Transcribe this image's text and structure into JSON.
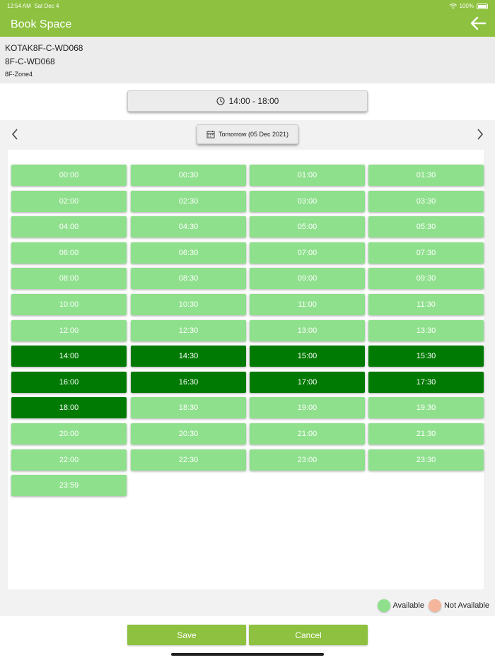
{
  "status": {
    "time": "12:54 AM",
    "date": "Sat Dec 4",
    "battery": "100%"
  },
  "header": {
    "title": "Book Space"
  },
  "space": {
    "code": "KOTAK8F-C-WD068",
    "desk": "8F-C-WD068",
    "zone": "8F-Zone4"
  },
  "time_range": "14:00 - 18:00",
  "date_label": "Tomorrow (05 Dec 2021)",
  "slots": [
    {
      "time": "00:00",
      "state": "available"
    },
    {
      "time": "00:30",
      "state": "available"
    },
    {
      "time": "01:00",
      "state": "available"
    },
    {
      "time": "01:30",
      "state": "available"
    },
    {
      "time": "02:00",
      "state": "available"
    },
    {
      "time": "02:30",
      "state": "available"
    },
    {
      "time": "03:00",
      "state": "available"
    },
    {
      "time": "03:30",
      "state": "available"
    },
    {
      "time": "04:00",
      "state": "available"
    },
    {
      "time": "04:30",
      "state": "available"
    },
    {
      "time": "05:00",
      "state": "available"
    },
    {
      "time": "05:30",
      "state": "available"
    },
    {
      "time": "06:00",
      "state": "available"
    },
    {
      "time": "06:30",
      "state": "available"
    },
    {
      "time": "07:00",
      "state": "available"
    },
    {
      "time": "07:30",
      "state": "available"
    },
    {
      "time": "08:00",
      "state": "available"
    },
    {
      "time": "08:30",
      "state": "available"
    },
    {
      "time": "09:00",
      "state": "available"
    },
    {
      "time": "09:30",
      "state": "available"
    },
    {
      "time": "10:00",
      "state": "available"
    },
    {
      "time": "10:30",
      "state": "available"
    },
    {
      "time": "11:00",
      "state": "available"
    },
    {
      "time": "11:30",
      "state": "available"
    },
    {
      "time": "12:00",
      "state": "available"
    },
    {
      "time": "12:30",
      "state": "available"
    },
    {
      "time": "13:00",
      "state": "available"
    },
    {
      "time": "13:30",
      "state": "available"
    },
    {
      "time": "14:00",
      "state": "selected"
    },
    {
      "time": "14:30",
      "state": "selected"
    },
    {
      "time": "15:00",
      "state": "selected"
    },
    {
      "time": "15:30",
      "state": "selected"
    },
    {
      "time": "16:00",
      "state": "selected"
    },
    {
      "time": "16:30",
      "state": "selected"
    },
    {
      "time": "17:00",
      "state": "selected"
    },
    {
      "time": "17:30",
      "state": "selected"
    },
    {
      "time": "18:00",
      "state": "selected"
    },
    {
      "time": "18:30",
      "state": "available"
    },
    {
      "time": "19:00",
      "state": "available"
    },
    {
      "time": "19:30",
      "state": "available"
    },
    {
      "time": "20:00",
      "state": "available"
    },
    {
      "time": "20:30",
      "state": "available"
    },
    {
      "time": "21:00",
      "state": "available"
    },
    {
      "time": "21:30",
      "state": "available"
    },
    {
      "time": "22:00",
      "state": "available"
    },
    {
      "time": "22:30",
      "state": "available"
    },
    {
      "time": "23:00",
      "state": "available"
    },
    {
      "time": "23:30",
      "state": "available"
    },
    {
      "time": "23:59",
      "state": "available"
    }
  ],
  "legend": {
    "available": "Available",
    "not_available": "Not Available"
  },
  "buttons": {
    "save": "Save",
    "cancel": "Cancel"
  },
  "colors": {
    "brand": "#8dc13f",
    "available": "#8ee08c",
    "selected": "#017a04",
    "not_available": "#f4b59a"
  },
  "icons": {
    "back": "arrow-left-icon",
    "clock": "clock-icon",
    "calendar": "calendar-icon",
    "prev": "chevron-left-icon",
    "next": "chevron-right-icon"
  }
}
